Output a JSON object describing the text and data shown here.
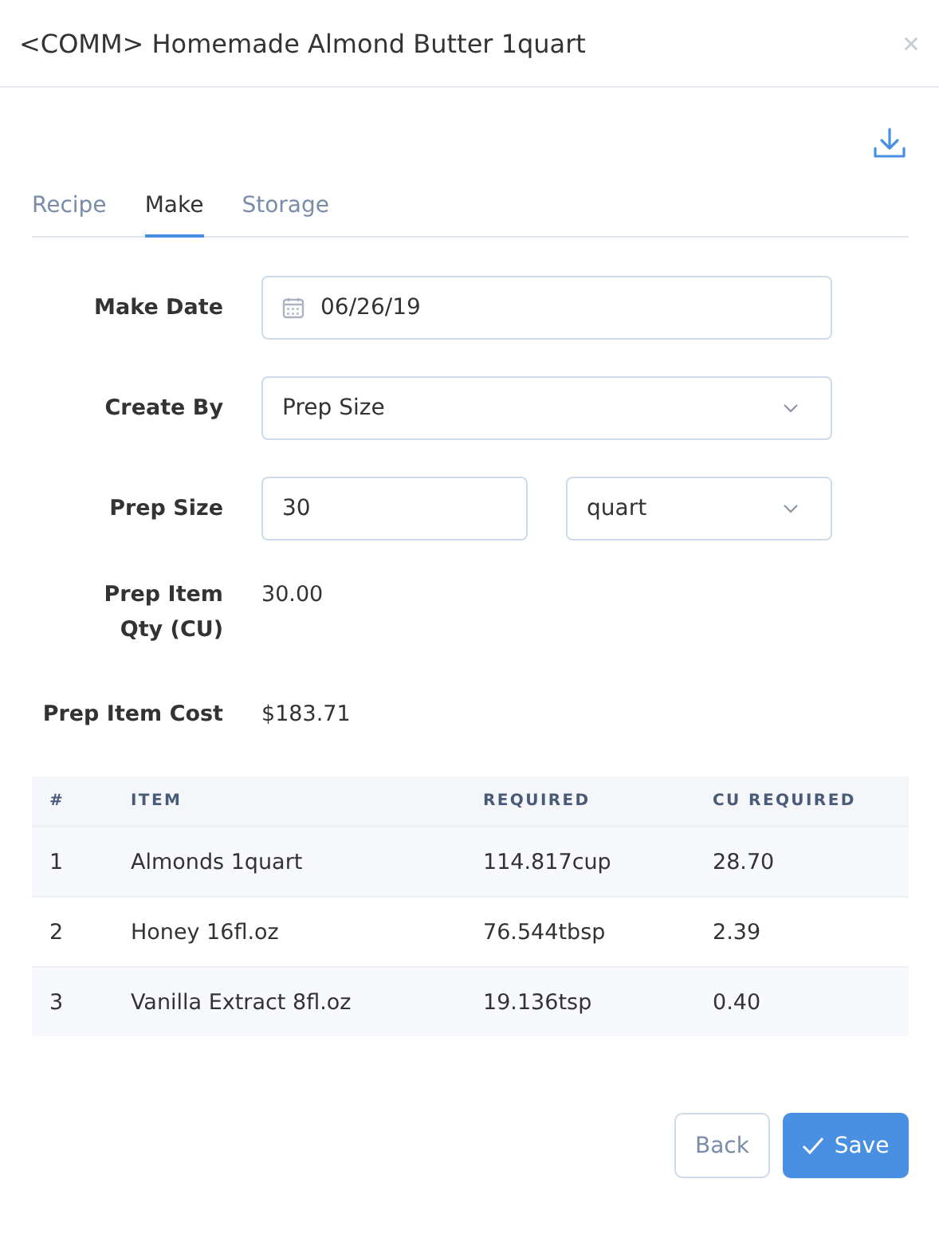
{
  "dialog": {
    "title": "<COMM> Homemade Almond Butter 1quart"
  },
  "tabs": [
    {
      "label": "Recipe",
      "selected": false
    },
    {
      "label": "Make",
      "selected": true
    },
    {
      "label": "Storage",
      "selected": false
    }
  ],
  "form": [
    {
      "kind": "date",
      "label": "Make Date",
      "value": "06/26/19"
    },
    {
      "kind": "select",
      "label": "Create By",
      "value": "Prep Size"
    },
    {
      "kind": "size",
      "label": "Prep Size",
      "value": "30",
      "unit": "quart"
    },
    {
      "kind": "text",
      "label": "Prep Item Qty (CU)",
      "value": "30.00"
    },
    {
      "kind": "text",
      "label": "Prep Item Cost",
      "value": "$183.71"
    }
  ],
  "table": {
    "columns": [
      "#",
      "ITEM",
      "REQUIRED",
      "CU REQUIRED"
    ],
    "rows": [
      [
        "1",
        "Almonds 1quart",
        "114.817cup",
        "28.70"
      ],
      [
        "2",
        "Honey 16fl.oz",
        "76.544tbsp",
        "2.39"
      ],
      [
        "3",
        "Vanilla Extract 8fl.oz",
        "19.136tsp",
        "0.40"
      ]
    ]
  },
  "buttons": {
    "back": "Back",
    "save": "Save"
  }
}
